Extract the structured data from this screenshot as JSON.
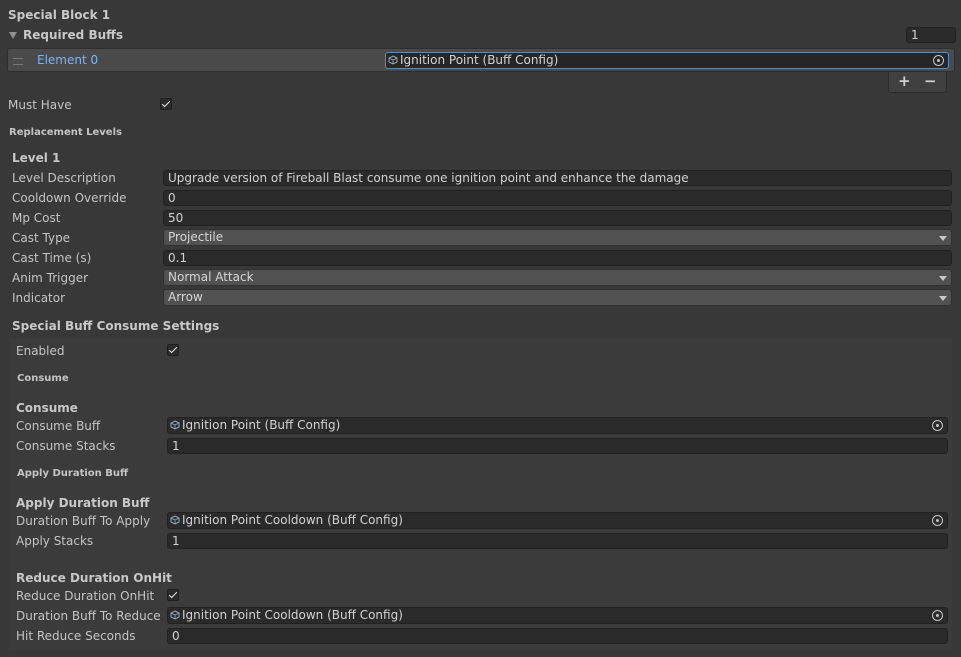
{
  "special_block_title": "Special Block 1",
  "required_buffs": {
    "label": "Required Buffs",
    "size": "1",
    "element_label": "Element 0",
    "element_value": "Ignition Point (Buff Config)",
    "add": "+",
    "remove": "−"
  },
  "must_have": {
    "label": "Must Have",
    "checked": true
  },
  "replacement_levels_label": "Replacement Levels",
  "level": {
    "title": "Level 1",
    "description": {
      "label": "Level Description",
      "value": "Upgrade version of Fireball Blast consume one ignition point and enhance the damage"
    },
    "cooldown_override": {
      "label": "Cooldown Override",
      "value": "0"
    },
    "mp_cost": {
      "label": "Mp Cost",
      "value": "50"
    },
    "cast_type": {
      "label": "Cast Type",
      "value": "Projectile"
    },
    "cast_time": {
      "label": "Cast Time (s)",
      "value": "0.1"
    },
    "anim_trigger": {
      "label": "Anim Trigger",
      "value": "Normal Attack"
    },
    "indicator": {
      "label": "Indicator",
      "value": "Arrow"
    }
  },
  "special_buff": {
    "title": "Special Buff Consume Settings",
    "enabled": {
      "label": "Enabled",
      "checked": true
    },
    "consume_section": "Consume",
    "consume_header": "Consume",
    "consume_buff": {
      "label": "Consume Buff",
      "value": "Ignition Point (Buff Config)"
    },
    "consume_stacks": {
      "label": "Consume Stacks",
      "value": "1"
    },
    "apply_section": "Apply Duration Buff",
    "apply_header": "Apply Duration Buff",
    "duration_buff_to_apply": {
      "label": "Duration Buff To Apply",
      "value": "Ignition Point Cooldown (Buff Config)"
    },
    "apply_stacks": {
      "label": "Apply Stacks",
      "value": "1"
    },
    "reduce_header": "Reduce Duration OnHit",
    "reduce_duration_onhit": {
      "label": "Reduce Duration OnHit",
      "checked": true
    },
    "duration_buff_to_reduce": {
      "label": "Duration Buff To Reduce",
      "value": "Ignition Point Cooldown (Buff Config)"
    },
    "hit_reduce_seconds": {
      "label": "Hit Reduce Seconds",
      "value": "0"
    }
  },
  "colors": {
    "background": "#383838",
    "field": "#2a2a2a",
    "accent": "#7ab3f0",
    "selected_row": "#4a4a4a"
  },
  "icons": [
    "foldout-arrow-icon",
    "drag-handle-icon",
    "scriptable-object-icon",
    "object-picker-icon",
    "checkmark-icon",
    "dropdown-caret-icon"
  ]
}
